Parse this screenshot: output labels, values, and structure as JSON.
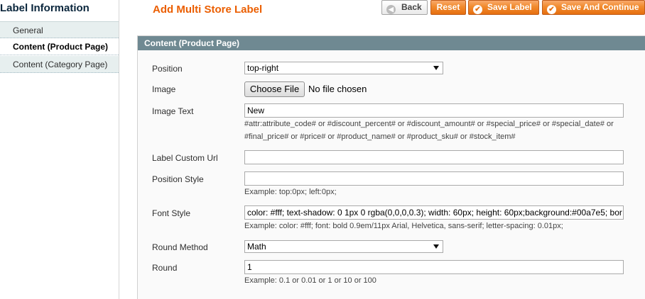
{
  "sidebar": {
    "title": "Label Information",
    "tabs": [
      {
        "label": "General"
      },
      {
        "label": "Content (Product Page)"
      },
      {
        "label": "Content (Category Page)"
      }
    ]
  },
  "header": {
    "title": "Add Multi Store Label",
    "buttons": {
      "back": "Back",
      "reset": "Reset",
      "save": "Save Label",
      "save_continue": "Save And Continue"
    }
  },
  "panel": {
    "title": "Content (Product Page)",
    "fields": {
      "position": {
        "label": "Position",
        "value": "top-right"
      },
      "image": {
        "label": "Image",
        "button": "Choose File",
        "status": "No file chosen"
      },
      "image_text": {
        "label": "Image Text",
        "value": "New",
        "note_line1": "#attr:attribute_code# or #discount_percent# or #discount_amount# or #special_price# or #special_date# or",
        "note_line2": "#final_price# or #price# or #product_name# or #product_sku# or #stock_item#"
      },
      "custom_url": {
        "label": "Label Custom Url",
        "value": ""
      },
      "position_style": {
        "label": "Position Style",
        "value": "",
        "note": "Example: top:0px; left:0px;"
      },
      "font_style": {
        "label": "Font Style",
        "value": "color: #fff; text-shadow: 0 1px 0 rgba(0,0,0,0.3); width: 60px; height: 60px;background:#00a7e5; bor",
        "note": "Example: color: #fff; font: bold 0.9em/11px Arial, Helvetica, sans-serif; letter-spacing: 0.01px;"
      },
      "round_method": {
        "label": "Round Method",
        "value": "Math"
      },
      "round": {
        "label": "Round",
        "value": "1",
        "note": "Example: 0.1 or 0.01 or 1 or 10 or 100"
      }
    }
  },
  "colors": {
    "accent": "#eb5e00",
    "header_bar": "#6f8992",
    "button": "#f18a2d"
  }
}
